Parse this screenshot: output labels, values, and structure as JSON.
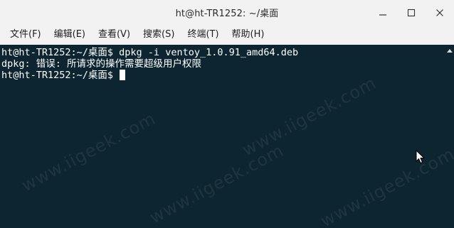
{
  "window": {
    "title": "ht@ht-TR1252: ~/桌面",
    "controls": [
      "minimize-icon",
      "maximize-icon",
      "close-icon"
    ]
  },
  "menubar": {
    "items": [
      {
        "label": "文件(F)"
      },
      {
        "label": "编辑(E)"
      },
      {
        "label": "查看(V)"
      },
      {
        "label": "搜索(S)"
      },
      {
        "label": "终端(T)"
      },
      {
        "label": "帮助(H)"
      }
    ]
  },
  "terminal": {
    "lines": [
      "ht@ht-TR1252:~/桌面$ dpkg -i ventoy_1.0.91_amd64.deb",
      "dpkg: 错误: 所请求的操作需要超级用户权限",
      "ht@ht-TR1252:~/桌面$ "
    ]
  },
  "watermark": {
    "text": "www.iigeek.com"
  },
  "colors": {
    "terminal_bg": "#0d2531",
    "terminal_fg": "#ffffff",
    "chrome_bg": "#f2f2f2"
  }
}
